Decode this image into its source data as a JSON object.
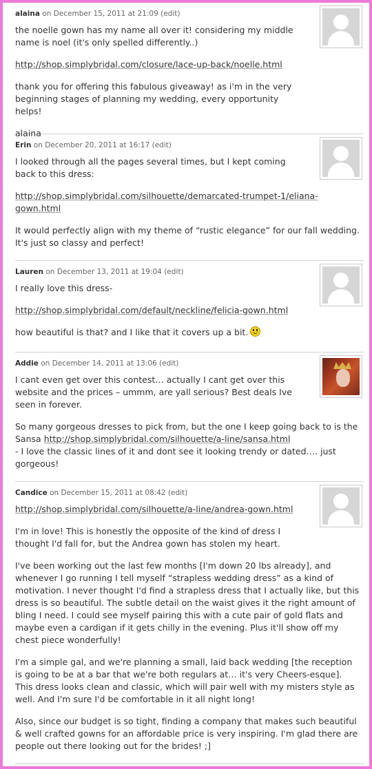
{
  "comments": [
    {
      "author": "alaina",
      "on": "on",
      "date": "December 15, 2011 at 21:09",
      "edit": "(edit)",
      "avatar": "default-avatar",
      "paragraphs": [
        "the noelle gown has my name all over it! considering my middle name is noel (it's only spelled differently..)",
        "http://shop.simplybridal.com/closure/lace-up-back/noelle.html",
        "thank you for offering this fabulous giveaway! as i'm in the very beginning stages of planning my wedding, every opportunity helps!",
        "alaina"
      ]
    },
    {
      "author": "Erin",
      "on": "on",
      "date": "December 20, 2011 at 16:17",
      "edit": "(edit)",
      "avatar": "default-avatar",
      "paragraphs": [
        "I looked through all the pages several times, but I kept coming back to this dress:",
        "http://shop.simplybridal.com/silhouette/demarcated-trumpet-1/eliana-gown.html",
        "It would perfectly align with my theme of “rustic elegance” for our fall wedding. It's just so classy and perfect!"
      ]
    },
    {
      "author": "Lauren",
      "on": "on",
      "date": "December 13, 2011 at 19:04",
      "edit": "(edit)",
      "avatar": "default-avatar",
      "paragraphs": [
        "I really love this dress-",
        "http://shop.simplybridal.com/default/neckline/felicia-gown.html",
        "how beautiful is that? and I like that it covers up a bit."
      ]
    },
    {
      "author": "Addie",
      "on": "on",
      "date": "December 14, 2011 at 13:06",
      "edit": "(edit)",
      "avatar": "user-photo",
      "paragraphs": [
        "I cant even get over this contest… actually I cant get over this website and the prices – ummm, are yall serious? Best deals Ive seen in forever.",
        "So many gorgeous dresses to pick from, but the one I keep going back to is the Sansa",
        "http://shop.simplybridal.com/silhouette/a-line/sansa.html",
        "- I love the classic lines of it and dont see it looking trendy or dated…. just gorgeous!"
      ]
    },
    {
      "author": "Candice",
      "on": "on",
      "date": "December 15, 2011 at 08:42",
      "edit": "(edit)",
      "avatar": "default-avatar",
      "paragraphs": [
        "http://shop.simplybridal.com/silhouette/a-line/andrea-gown.html",
        "I'm in love! This is honestly the opposite of the kind of dress I thought I'd fall for, but the Andrea gown has stolen my heart.",
        "I've been working out the last few months [I'm down 20 lbs already], and whenever I go running I tell myself “strapless wedding dress” as a kind of motivation. I never thought I'd find a strapless dress that I actually like, but this dress is so beautiful. The subtle detail on the waist gives it the right amount of bling I need. I could see myself pairing this with a cute pair of gold flats and maybe even a cardigan if it gets chilly in the evening. Plus it'll show off my chest piece wonderfully!",
        "I'm a simple gal, and we're planning a small, laid back wedding [the reception is going to be at a bar that we're both regulars at… it's very Cheers-esque]. This dress looks clean and classic, which will pair well with my misters style as well. And I'm sure I'd be comfortable in it all night long!",
        "Also, since our budget is so tight, finding a company that makes such beautiful & well crafted gowns for an affordable price is very inspiring. I'm glad there are people out there looking out for the brides! ;]"
      ]
    }
  ],
  "colors": {
    "frame": "#ec7ad9",
    "text": "#333333",
    "meta": "#666666"
  }
}
